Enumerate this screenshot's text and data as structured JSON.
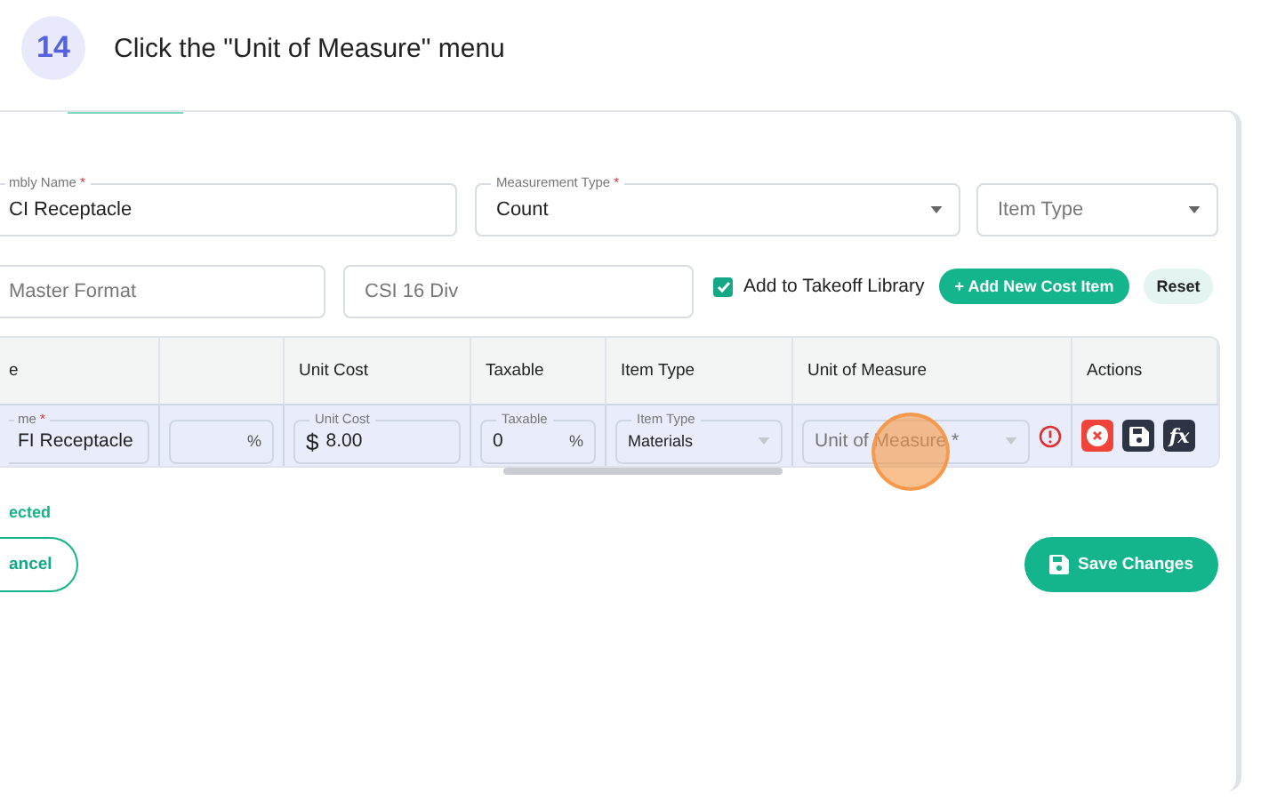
{
  "step": {
    "number": "14",
    "text": "Click the \"Unit of Measure\" menu"
  },
  "form": {
    "row_1": [
      {
        "kind": "text",
        "label": "mbly Name",
        "required_mark": "*",
        "value": "CI Receptacle"
      },
      {
        "kind": "select",
        "label": "Measurement Type",
        "required_mark": "*",
        "value": "Count"
      },
      {
        "kind": "select",
        "placeholder": "Item Type"
      }
    ],
    "row_2": [
      {
        "placeholder": "Master Format"
      },
      {
        "placeholder": "CSI 16 Div"
      }
    ],
    "add_to_library": {
      "label": "Add to Takeoff Library",
      "checked": true
    },
    "add_button": "+ Add New Cost Item",
    "reset_button": "Reset"
  },
  "table": {
    "columns": [
      {
        "label": "e"
      },
      {},
      {
        "label": "Unit Cost"
      },
      {
        "label": "Taxable"
      },
      {
        "label": "Item Type"
      },
      {
        "label": "Unit of Measure"
      },
      {
        "label": "Actions"
      }
    ],
    "row": [
      {
        "kind": "text",
        "label": "me",
        "required_mark": "*",
        "value": "FI Receptacle"
      },
      {
        "kind": "text",
        "suffix": "%"
      },
      {
        "kind": "text",
        "label": "Unit Cost",
        "prefix": "$",
        "value": "8.00"
      },
      {
        "kind": "text",
        "label": "Taxable",
        "value": "0",
        "suffix": "%"
      },
      {
        "kind": "select",
        "label": "Item Type",
        "value": "Materials"
      },
      {
        "kind": "select",
        "placeholder": "Unit of Measure *",
        "error": true
      },
      {
        "kind": "actions",
        "actions": [
          {
            "kind": "delete"
          },
          {
            "kind": "save"
          },
          {
            "kind": "formula",
            "text": "fx"
          }
        ]
      }
    ]
  },
  "selection_text": "ected",
  "cancel_button": "ancel",
  "save_button": "Save Changes"
}
